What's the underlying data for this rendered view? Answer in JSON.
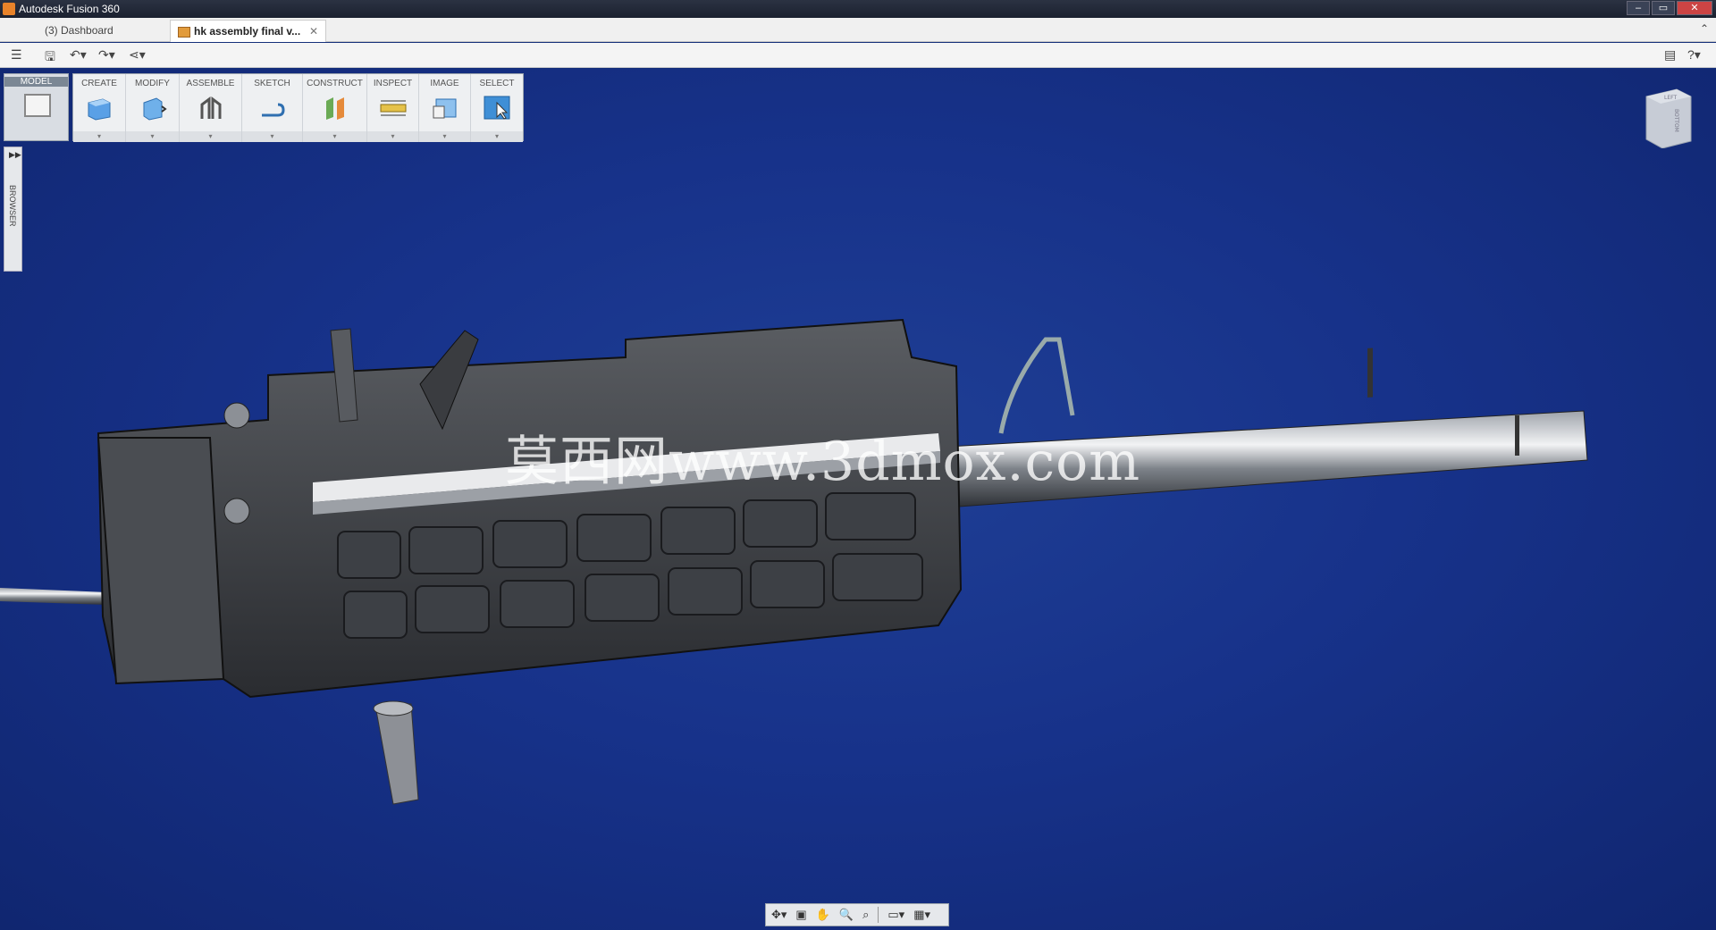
{
  "window": {
    "title": "Autodesk Fusion 360",
    "min_icon": "minimize-icon",
    "max_icon": "maximize-icon",
    "close_icon": "close-icon"
  },
  "tabs": [
    {
      "label": "(3) Dashboard"
    },
    {
      "label": "hk assembly final v..."
    }
  ],
  "ribbon": {
    "model_label": "MODEL",
    "groups": [
      "CREATE",
      "MODIFY",
      "ASSEMBLE",
      "SKETCH",
      "CONSTRUCT",
      "INSPECT",
      "IMAGE",
      "SELECT"
    ],
    "dropdown_glyph": "▾"
  },
  "browser": {
    "label": "BROWSER"
  },
  "viewcube": {
    "face_top": "LEFT",
    "face_front": "BOTTOM"
  },
  "watermark": "莫西网www.3dmox.com",
  "colors": {
    "viewport": "#17328a",
    "accent": "#e8832a"
  }
}
